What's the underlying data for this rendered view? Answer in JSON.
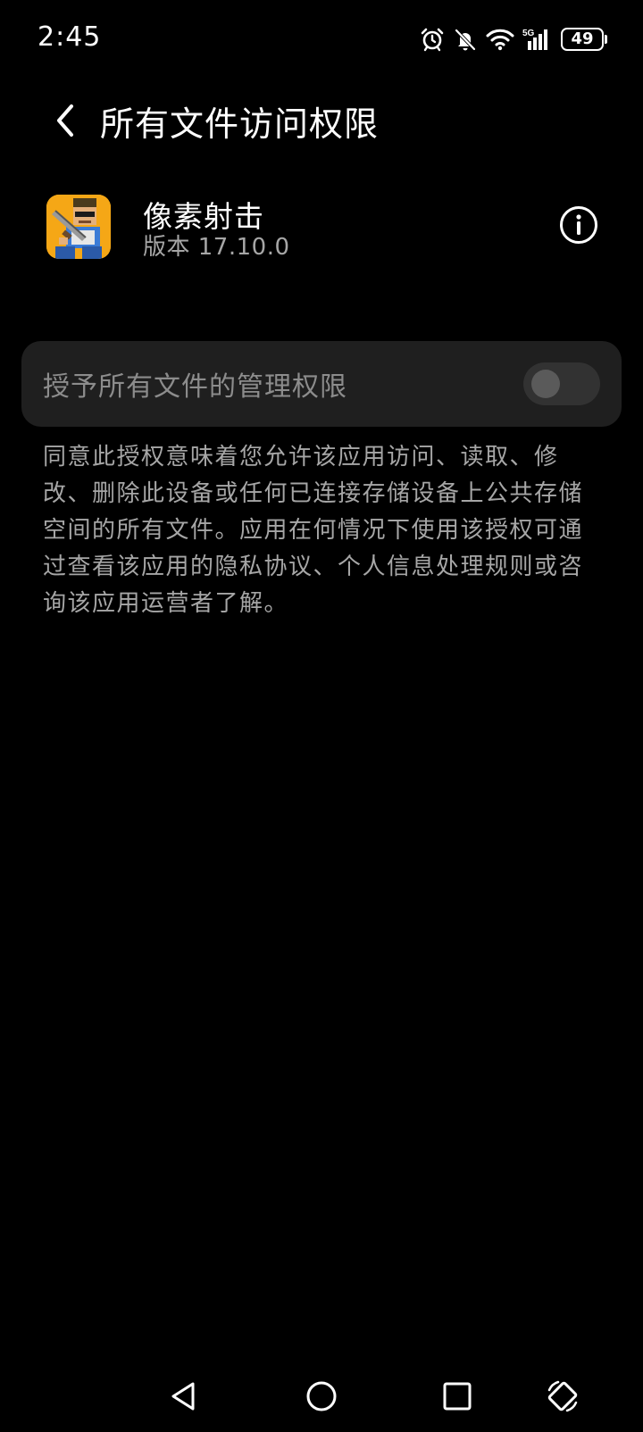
{
  "status_bar": {
    "time": "2:45",
    "battery_level": "49",
    "network": "5G",
    "icons": [
      "alarm-icon",
      "bell-muted-icon",
      "wifi-icon",
      "signal-5g-icon",
      "battery-icon"
    ]
  },
  "app_bar": {
    "title": "所有文件访问权限",
    "back_icon": "chevron-left-icon"
  },
  "app": {
    "name": "像素射击",
    "version": "版本 17.10.0",
    "info_icon": "info-icon"
  },
  "permission": {
    "label": "授予所有文件的管理权限",
    "enabled": false
  },
  "description": "同意此授权意味着您允许该应用访问、读取、修改、删除此设备或任何已连接存储设备上公共存储空间的所有文件。应用在何情况下使用该授权可通过查看该应用的隐私协议、个人信息处理规则或咨询该应用运营者了解。",
  "nav_bar": {
    "icons": [
      "back-triangle-icon",
      "home-circle-icon",
      "recents-square-icon",
      "rotate-screen-icon"
    ]
  },
  "colors": {
    "background": "#000000",
    "card": "#1f1f1f",
    "primary_text": "#ffffff",
    "secondary_text": "#a6a6a6",
    "disabled_text": "#8c8c8c"
  }
}
